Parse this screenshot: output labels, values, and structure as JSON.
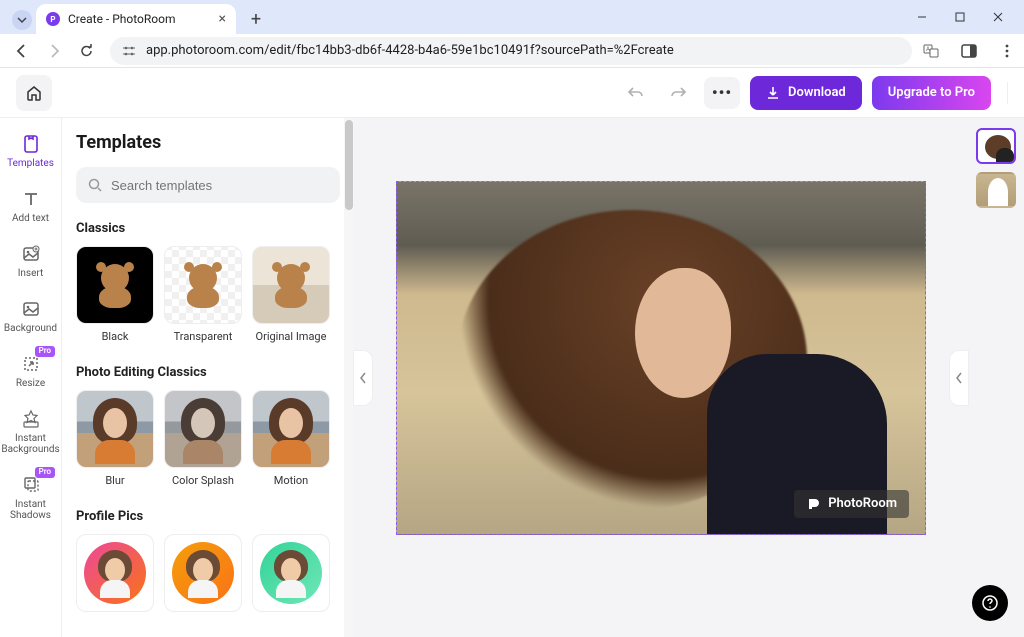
{
  "browser": {
    "tab_title": "Create - PhotoRoom",
    "url": "app.photoroom.com/edit/fbc14bb3-db6f-4428-b4a6-59e1bc10491f?sourcePath=%2Fcreate"
  },
  "topbar": {
    "download_label": "Download",
    "upgrade_label": "Upgrade to Pro"
  },
  "rail": {
    "items": [
      {
        "label": "Templates",
        "pro": false
      },
      {
        "label": "Add text",
        "pro": false
      },
      {
        "label": "Insert",
        "pro": false
      },
      {
        "label": "Background",
        "pro": false
      },
      {
        "label": "Resize",
        "pro": true
      },
      {
        "label": "Instant Backgrounds",
        "pro": false
      },
      {
        "label": "Instant Shadows",
        "pro": true
      }
    ],
    "pro_badge": "Pro"
  },
  "panel": {
    "title": "Templates",
    "search_placeholder": "Search templates",
    "sections": {
      "classics": {
        "title": "Classics",
        "items": [
          "Black",
          "Transparent",
          "Original Image"
        ]
      },
      "photo_editing": {
        "title": "Photo Editing Classics",
        "items": [
          "Blur",
          "Color Splash",
          "Motion"
        ]
      },
      "profile": {
        "title": "Profile Pics"
      }
    }
  },
  "canvas": {
    "watermark": "PhotoRoom"
  }
}
